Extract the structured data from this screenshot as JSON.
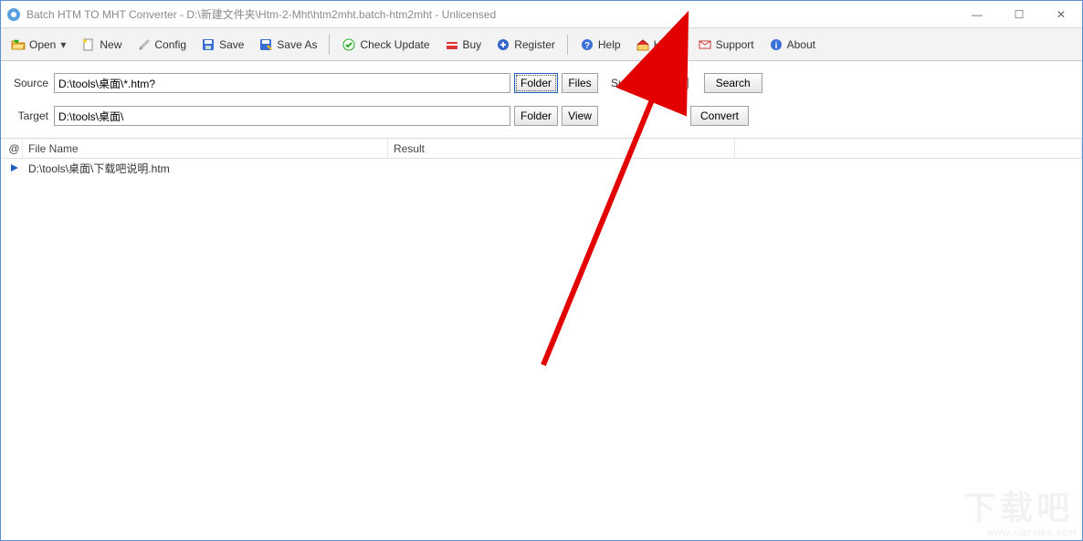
{
  "window": {
    "title": "Batch HTM TO MHT Converter - D:\\新建文件夹\\Htm-2-Mht\\htm2mht.batch-htm2mht - Unlicensed"
  },
  "win_controls": {
    "min": "—",
    "max": "☐",
    "close": "✕"
  },
  "toolbar": {
    "open": "Open",
    "new": "New",
    "config": "Config",
    "save": "Save",
    "save_as": "Save As",
    "check_update": "Check Update",
    "buy": "Buy",
    "register": "Register",
    "help": "Help",
    "home": "Home",
    "support": "Support",
    "about": "About"
  },
  "paths": {
    "source_label": "Source",
    "source_value": "D:\\tools\\桌面\\*.htm?",
    "target_label": "Target",
    "target_value": "D:\\tools\\桌面\\",
    "folder_btn": "Folder",
    "files_btn": "Files",
    "view_btn": "View",
    "subfolders_label": "Sub folders",
    "search_btn": "Search",
    "convert_btn": "Convert"
  },
  "list": {
    "hdr_at": "@",
    "hdr_file": "File Name",
    "hdr_result": "Result",
    "rows": [
      {
        "file": "D:\\tools\\桌面\\下载吧说明.htm",
        "result": ""
      }
    ]
  },
  "watermark_small": "www.xiazaiba.com",
  "watermark_big": "下载吧"
}
